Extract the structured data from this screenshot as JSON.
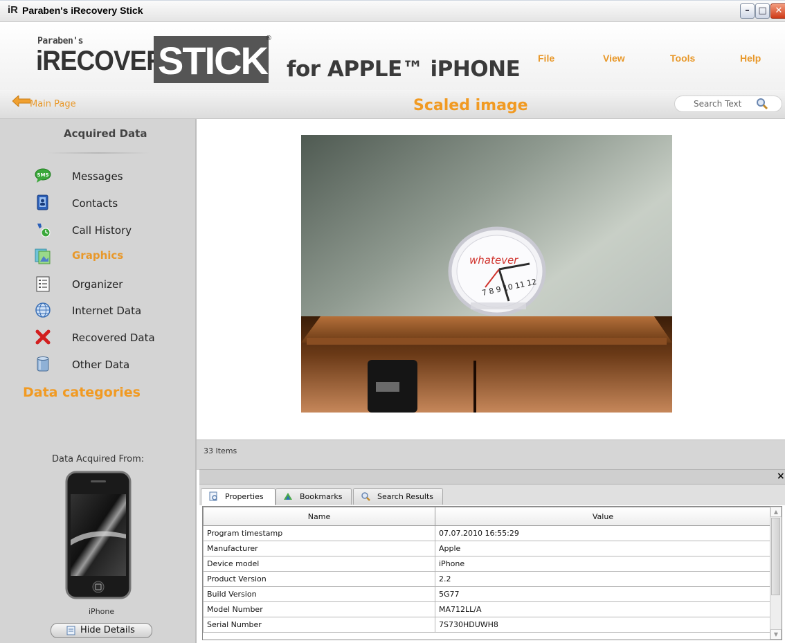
{
  "window": {
    "logo_text": "iR",
    "title": "Paraben's iRecovery Stick",
    "minimize_glyph": "–",
    "maximize_glyph": "□",
    "close_glyph": "✕"
  },
  "brand": {
    "small": "Paraben's",
    "name_left": "iRECOVERY",
    "name_right": "STICK",
    "registered": "®",
    "subtitle": "for APPLE™ iPHONE"
  },
  "menu": {
    "file": "File",
    "view": "View",
    "tools": "Tools",
    "help": "Help"
  },
  "nav": {
    "back_label": "Main Page",
    "page_title": "Scaled image",
    "search_placeholder": "Search Text"
  },
  "sidebar": {
    "heading": "Acquired Data",
    "items": [
      {
        "label": "Messages",
        "icon": "sms-icon"
      },
      {
        "label": "Contacts",
        "icon": "contacts-icon"
      },
      {
        "label": "Call History",
        "icon": "call-history-icon"
      },
      {
        "label": "Graphics",
        "icon": "graphics-icon",
        "selected": true
      },
      {
        "label": "Organizer",
        "icon": "organizer-icon"
      },
      {
        "label": "Internet Data",
        "icon": "globe-icon"
      },
      {
        "label": "Recovered Data",
        "icon": "red-x-icon"
      },
      {
        "label": "Other Data",
        "icon": "database-icon"
      }
    ],
    "categories_label": "Data categories",
    "acquired_from": "Data Acquired From:",
    "device_name": "iPhone",
    "hide_details": "Hide Details"
  },
  "viewer": {
    "items_count": "33 Items",
    "clock_text": "whatever"
  },
  "details": {
    "close_glyph": "×",
    "tabs": [
      {
        "label": "Properties",
        "icon": "properties-icon",
        "active": true
      },
      {
        "label": "Bookmarks",
        "icon": "bookmarks-icon"
      },
      {
        "label": "Search Results",
        "icon": "search-icon"
      }
    ],
    "columns": [
      "Name",
      "Value"
    ],
    "rows": [
      [
        "Program timestamp",
        "07.07.2010 16:55:29"
      ],
      [
        "Manufacturer",
        "Apple"
      ],
      [
        "Device model",
        "iPhone"
      ],
      [
        "Product Version",
        "2.2"
      ],
      [
        "Build Version",
        "5G77"
      ],
      [
        "Model Number",
        "MA712LL/A"
      ],
      [
        "Serial Number",
        "7S730HDUWH8"
      ]
    ]
  },
  "colors": {
    "accent": "#f19a22",
    "sidebar_bg": "#d4d4d4"
  }
}
